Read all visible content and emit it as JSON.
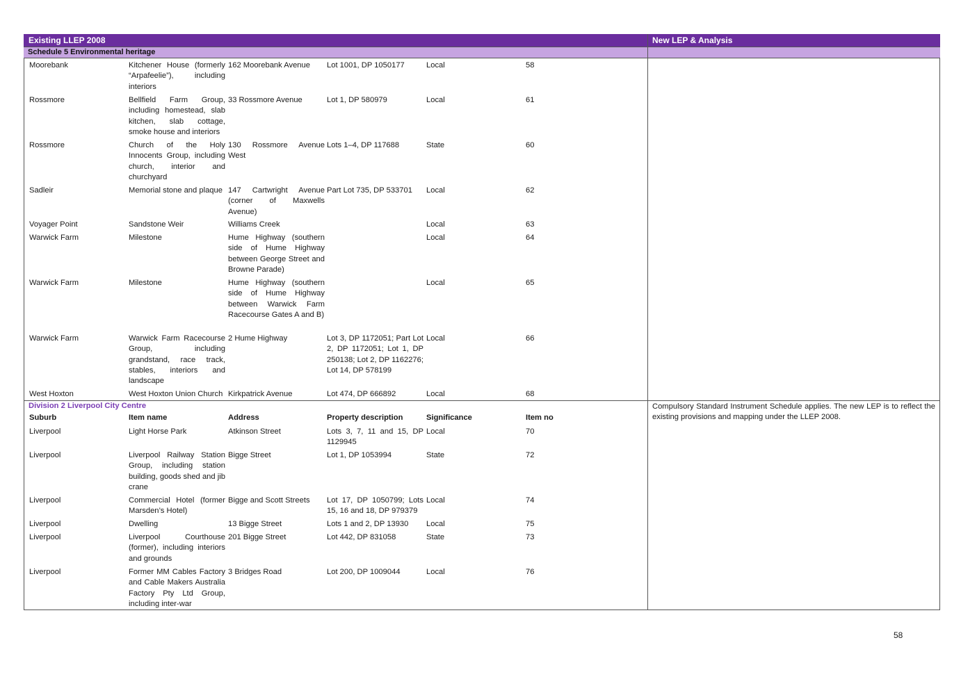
{
  "header": {
    "left": "Existing LLEP 2008",
    "right": "New LEP & Analysis"
  },
  "schedule_title": "Schedule 5 Environmental heritage",
  "rows_a": [
    {
      "suburb": "Moorebank",
      "item": "Kitchener House (formerly “Arpafeelie”), including interiors",
      "address": "162 Moorebank Avenue",
      "property": "Lot 1001, DP 1050177",
      "significance": "Local",
      "no": "58"
    },
    {
      "suburb": "Rossmore",
      "item": "Bellfield Farm Group, including homestead, slab kitchen, slab cottage, smoke house and interiors",
      "address": "33 Rossmore Avenue",
      "property": "Lot 1, DP 580979",
      "significance": "Local",
      "no": "61"
    },
    {
      "suburb": "Rossmore",
      "item": "Church of the Holy Innocents Group, including church, interior and churchyard",
      "address": "130 Rossmore Avenue West",
      "property": "Lots 1–4, DP 117688",
      "significance": "State",
      "no": "60"
    },
    {
      "suburb": "Sadleir",
      "item": "Memorial stone and plaque",
      "address": "147 Cartwright Avenue (corner of Maxwells Avenue)",
      "property": "Part Lot 735, DP 533701",
      "significance": "Local",
      "no": "62"
    },
    {
      "suburb": "Voyager Point",
      "item": "Sandstone Weir",
      "address": "Williams Creek",
      "property": "",
      "significance": "Local",
      "no": "63"
    },
    {
      "suburb": "Warwick Farm",
      "item": "Milestone",
      "address": "Hume Highway (southern side of Hume Highway between George Street and Browne Parade)",
      "property": "",
      "significance": "Local",
      "no": "64"
    },
    {
      "suburb": "Warwick Farm",
      "item": "Milestone",
      "address": "Hume Highway (southern side of Hume Highway between Warwick Farm Racecourse Gates A and B)",
      "property": "",
      "significance": "Local",
      "no": "65"
    },
    {
      "suburb": "Warwick Farm",
      "item": "Warwick Farm Racecourse Group, including grandstand, race track, stables, interiors and landscape",
      "address": "2 Hume Highway",
      "property": "Lot 3, DP 1172051; Part Lot 2, DP 1172051; Lot 1, DP 250138; Lot 2, DP 1162276; Lot 14, DP 578199",
      "significance": "Local",
      "no": "66"
    },
    {
      "suburb": "West Hoxton",
      "item": "West Hoxton Union Church",
      "address": "Kirkpatrick Avenue",
      "property": "Lot 474, DP 666892",
      "significance": "Local",
      "no": "68"
    }
  ],
  "division_title": "Division 2 Liverpool City Centre",
  "columns": {
    "suburb": "Suburb",
    "item": "Item name",
    "address": "Address",
    "property": "Property description",
    "significance": "Significance",
    "no": "Item no"
  },
  "rows_b": [
    {
      "suburb": "Liverpool",
      "item": "Light Horse Park",
      "address": "Atkinson Street",
      "property": "Lots 3, 7, 11 and 15, DP 1129945",
      "significance": "Local",
      "no": "70"
    },
    {
      "suburb": "Liverpool",
      "item": "Liverpool Railway Station Group, including station building, goods shed and jib crane",
      "address": "Bigge Street",
      "property": "Lot 1, DP 1053994",
      "significance": "State",
      "no": "72"
    },
    {
      "suburb": "Liverpool",
      "item": "Commercial Hotel (former Marsden’s Hotel)",
      "address": "Bigge and Scott Streets",
      "property": "Lot 17, DP 1050799; Lots 15, 16 and 18, DP 979379",
      "significance": "Local",
      "no": "74"
    },
    {
      "suburb": "Liverpool",
      "item": "Dwelling",
      "address": "13 Bigge Street",
      "property": "Lots 1 and 2, DP 13930",
      "significance": "Local",
      "no": "75"
    },
    {
      "suburb": "Liverpool",
      "item": "Liverpool Courthouse (former), including interiors and grounds",
      "address": "201 Bigge Street",
      "property": "Lot 442, DP 831058",
      "significance": "State",
      "no": "73"
    },
    {
      "suburb": "Liverpool",
      "item": "Former MM Cables Factory and Cable Makers Australia Factory Pty Ltd Group, including inter-war",
      "address": "3 Bridges Road",
      "property": "Lot 200, DP 1009044",
      "significance": "Local",
      "no": "76"
    }
  ],
  "analysis_note": "Compulsory Standard Instrument Schedule applies. The new LEP is to reflect the existing provisions and mapping under the LLEP 2008.",
  "page_number": "58"
}
